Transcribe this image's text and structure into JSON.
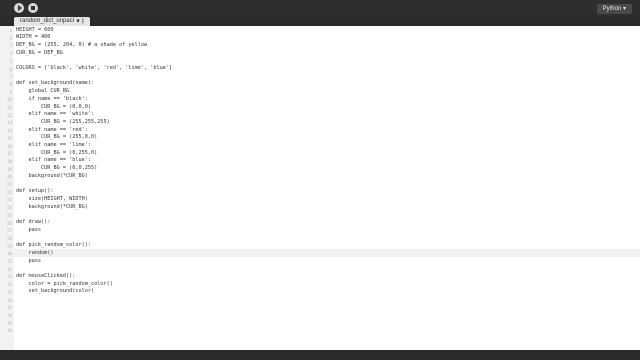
{
  "toolbar": {
    "mode_label": "Python ▾"
  },
  "tabs": {
    "active": "random_dict_unpacking",
    "add_label": "▾"
  },
  "editor": {
    "line_numbers": [
      "1",
      "2",
      "3",
      "4",
      "5",
      "6",
      "7",
      "8",
      "9",
      "10",
      "11",
      "12",
      "13",
      "14",
      "15",
      "16",
      "17",
      "18",
      "19",
      "20",
      "21",
      "22",
      "23",
      "24",
      "25",
      "26",
      "27",
      "28",
      "29",
      "30",
      "31",
      "32",
      "33",
      "34",
      "35",
      "36",
      "37",
      "38",
      "39",
      "40"
    ],
    "lines": [
      "HEIGHT = 600",
      "WIDTH = 400",
      "DEF_BG = (255, 204, 0) # a shade of yellow",
      "CUR_BG = DEF_BG",
      "",
      "COLORS = ['black', 'white', 'red', 'lime', 'blue']",
      "",
      "def set_background(name):",
      "    global CUR_BG",
      "    if name == 'black':",
      "        CUR_BG = (0,0,0)",
      "    elif name == 'white':",
      "        CUR_BG = (255,255,255)",
      "    elif name == 'red':",
      "        CUR_BG = (255,0,0)",
      "    elif name == 'lime':",
      "        CUR_BG = (0,255,0)",
      "    elif name == 'blue':",
      "        CUR_BG = (0,0,255)",
      "    background(*CUR_BG)",
      "",
      "def setup():",
      "    size(HEIGHT, WIDTH)",
      "    background(*CUR_BG)",
      "",
      "def draw():",
      "    pass",
      "",
      "def pick_random_color():",
      "    random()",
      "    pass",
      "",
      "def mouseClicked():",
      "    color = pick_random_color()",
      "    set_background(color)",
      "",
      "",
      "",
      "",
      ""
    ]
  }
}
